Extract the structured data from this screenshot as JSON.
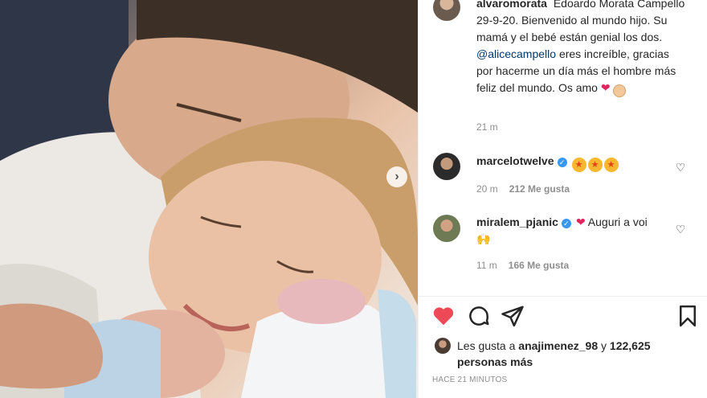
{
  "post": {
    "username": "alvaromorata",
    "caption_text": "Edoardo Morata Campello 29-9-20. Bienvenido al mundo hijo. Su mamá y el bebé están genial los dos.",
    "caption_mention": "@alicecampello",
    "caption_text_2": "eres increíble, gracias por hacerme un día más el hombre más feliz del mundo. Os amo",
    "time": "21 m"
  },
  "comments": [
    {
      "username": "marcelotwelve",
      "time": "20 m",
      "likes": "212 Me gusta"
    },
    {
      "username": "miralem_pjanic",
      "text": "Auguri a voi",
      "time": "11 m",
      "likes": "166 Me gusta"
    }
  ],
  "likes": {
    "prefix": "Les gusta a",
    "user": "anajimenez_98",
    "connector": "y",
    "count": "122,625 personas más"
  },
  "footer": {
    "time_ago": "HACE 21 MINUTOS"
  },
  "colors": {
    "like_red": "#ed4956",
    "link_blue": "#00376b",
    "verified_blue": "#3897f0"
  },
  "icons": [
    "carousel-next-icon",
    "verified-icon",
    "heart-icon",
    "comment-icon",
    "share-icon",
    "bookmark-icon"
  ]
}
